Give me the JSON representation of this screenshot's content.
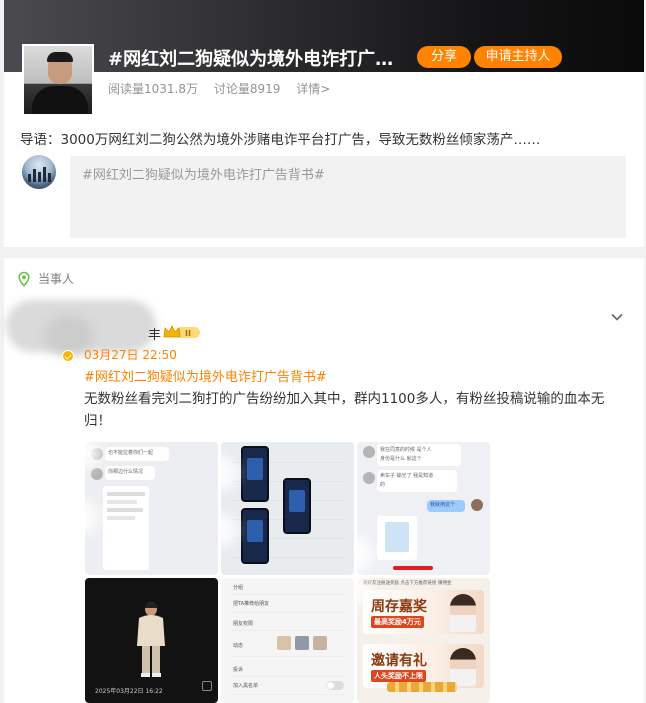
{
  "topic": {
    "title": "#网红刘二狗疑似为境外电诈打广…",
    "share_label": "分享",
    "apply_host_label": "申请主持人",
    "reads": "阅读量1031.8万",
    "discussions": "讨论量8919",
    "details_link": "详情>",
    "intro": "导语：3000万网红刘二狗公然为境外涉赌电诈平台打广告，导致无数粉丝倾家荡产……",
    "compose_placeholder": "#网红刘二狗疑似为境外电诈打广告背书#"
  },
  "feed": {
    "section_label": "当事人",
    "post": {
      "author_fragment": "丰",
      "badge_level": "II",
      "time": "03月27日 22:50",
      "hashtag": "#网红刘二狗疑似为境外电诈打广告背书#",
      "text": "无数粉丝看完刘二狗打的广告纷纷加入其中，群内1100多人，有粉丝投稿说输的血本无归！"
    },
    "images": {
      "img1_lines": [
        "也不能拉着你们一起",
        "你那边什么情况"
      ],
      "img3_lines": [
        "我在同意的时候 是个人",
        "身份是什么 就这个",
        "卖车子 输光了 我是知道",
        "的"
      ],
      "img3_reply": "我就用这个",
      "img4_stamp": "2025年03月22日 16:22",
      "img5_items": [
        "分组",
        "把TA推荐给朋友",
        "朋友权限",
        "动态",
        "投诉",
        "加入黑名单"
      ],
      "img6_header": "邀好友注册送奖励 点击下方推荐链接 赚佣金",
      "promo1_title": "周存嘉奖",
      "promo1_sub": "最高奖励4万元",
      "promo2_title": "邀请有礼",
      "promo2_sub": "人头奖励不上限"
    }
  },
  "colors": {
    "accent": "#ff8200",
    "banner_dark": "#0a0a0b",
    "compose_bg": "#f2f2f2"
  }
}
